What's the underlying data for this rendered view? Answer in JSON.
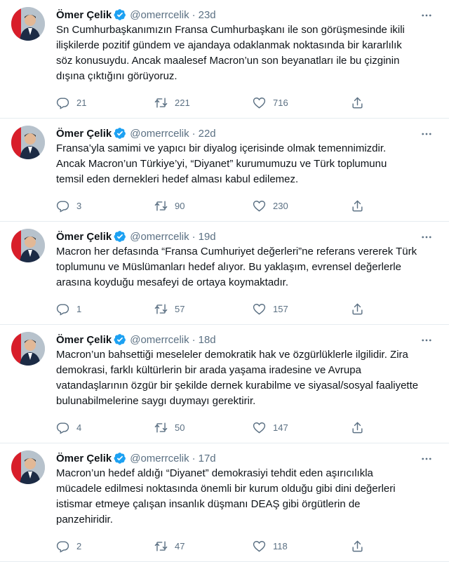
{
  "tweets": [
    {
      "name": "Ömer Çelik",
      "handle": "@omerrcelik",
      "separator": "·",
      "time": "23d",
      "text": "Sn Cumhurbaşkanımızın Fransa Cumhurbaşkanı ile son görüşmesinde ikili\nilişkilerde pozitif gündem ve ajandaya odaklanmak noktasında bir kararlılık\nsöz konusuydu. Ancak maalesef Macron’un son beyanatları ile bu çizginin\ndışına çıktığını görüyoruz.",
      "replies": "21",
      "retweets": "221",
      "likes": "716"
    },
    {
      "name": "Ömer Çelik",
      "handle": "@omerrcelik",
      "separator": "·",
      "time": "22d",
      "text": "Fransa’yla samimi ve yapıcı bir diyalog içerisinde olmak temennimizdir.\nAncak Macron’un Türkiye’yi, “Diyanet” kurumumuzu ve Türk toplumunu\ntemsil eden dernekleri hedef alması kabul edilemez.",
      "replies": "3",
      "retweets": "90",
      "likes": "230"
    },
    {
      "name": "Ömer Çelik",
      "handle": "@omerrcelik",
      "separator": "·",
      "time": "19d",
      "text": "Macron her defasında “Fransa Cumhuriyet değerleri”ne referans vererek Türk\ntoplumunu ve Müslümanları hedef alıyor. Bu yaklaşım, evrensel değerlerle\narasına koyduğu mesafeyi de ortaya koymaktadır.",
      "replies": "1",
      "retweets": "57",
      "likes": "157"
    },
    {
      "name": "Ömer Çelik",
      "handle": "@omerrcelik",
      "separator": "·",
      "time": "18d",
      "text": "Macron’un bahsettiği meseleler demokratik hak ve özgürlüklerle ilgilidir. Zira\ndemokrasi, farklı kültürlerin bir arada yaşama iradesine ve Avrupa\nvatandaşlarının özgür bir şekilde dernek kurabilme ve siyasal/sosyal faaliyette\nbulunabilmelerine saygı duymayı gerektirir.",
      "replies": "4",
      "retweets": "50",
      "likes": "147"
    },
    {
      "name": "Ömer Çelik",
      "handle": "@omerrcelik",
      "separator": "·",
      "time": "17d",
      "text": "Macron’un hedef aldığı “Diyanet” demokrasiyi tehdit eden aşırıcılıkla\nmücadele edilmesi noktasında önemli bir kurum olduğu gibi dini değerleri\nistismar etmeye çalışan insanlık düşmanı DEAŞ gibi örgütlerin de\npanzehiridir.",
      "replies": "2",
      "retweets": "47",
      "likes": "118"
    }
  ],
  "icons": {
    "verified": "verified-badge-icon",
    "more": "more-icon",
    "reply": "reply-icon",
    "retweet": "retweet-icon",
    "like": "heart-icon",
    "share": "share-icon"
  },
  "colors": {
    "text": "#0f1419",
    "secondary": "#5b7083",
    "verified": "#1da1f2",
    "divider": "#e6ecf0"
  }
}
